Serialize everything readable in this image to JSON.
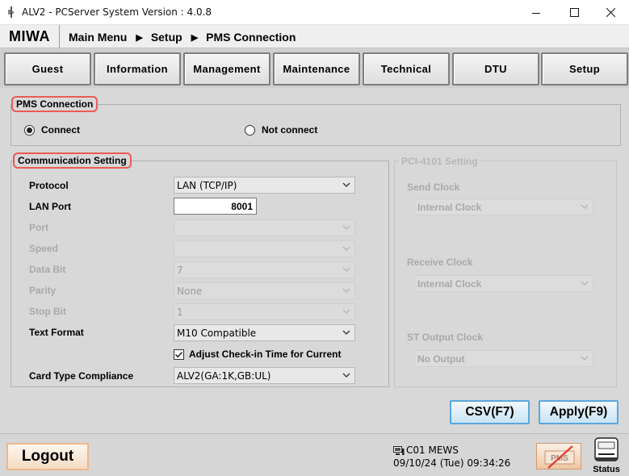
{
  "window": {
    "title": "ALV2 - PCServer System Version : 4.0.8"
  },
  "header": {
    "brand": "MIWA",
    "breadcrumb": [
      "Main Menu",
      "Setup",
      "PMS Connection"
    ]
  },
  "tabs": [
    "Guest",
    "Information",
    "Management",
    "Maintenance",
    "Technical",
    "DTU",
    "Setup"
  ],
  "pms_connection": {
    "legend": "PMS Connection",
    "options": [
      "Connect",
      "Not connect"
    ],
    "selected": "Connect"
  },
  "communication": {
    "legend": "Communication Setting",
    "protocol": {
      "label": "Protocol",
      "value": "LAN (TCP/IP)"
    },
    "lan_port": {
      "label": "LAN Port",
      "value": "8001"
    },
    "port": {
      "label": "Port",
      "value": ""
    },
    "speed": {
      "label": "Speed",
      "value": ""
    },
    "data_bit": {
      "label": "Data Bit",
      "value": "7"
    },
    "parity": {
      "label": "Parity",
      "value": "None"
    },
    "stop_bit": {
      "label": "Stop Bit",
      "value": "1"
    },
    "text_format": {
      "label": "Text Format",
      "value": "M10 Compatible"
    },
    "adjust_checkin": {
      "label": "Adjust Check-in Time for Current",
      "checked": true
    },
    "card_type": {
      "label": "Card Type Compliance",
      "value": "ALV2(GA:1K,GB:UL)"
    }
  },
  "pci": {
    "legend": "PCI-4101 Setting",
    "send_clock": {
      "label": "Send Clock",
      "value": "Internal Clock"
    },
    "receive_clock": {
      "label": "Receive Clock",
      "value": "Internal Clock"
    },
    "st_output_clock": {
      "label": "ST Output Clock",
      "value": "No Output"
    }
  },
  "actions": {
    "csv": "CSV(F7)",
    "apply": "Apply(F9)"
  },
  "footer": {
    "logout": "Logout",
    "terminal": "C01 MEWS",
    "datetime": "09/10/24 (Tue) 09:34:26",
    "pms_badge": "PMS",
    "status_label": "Status"
  },
  "colors": {
    "highlight": "#ec5a55",
    "action_border": "#5aa7dc",
    "logout_border": "#f0b78a"
  }
}
